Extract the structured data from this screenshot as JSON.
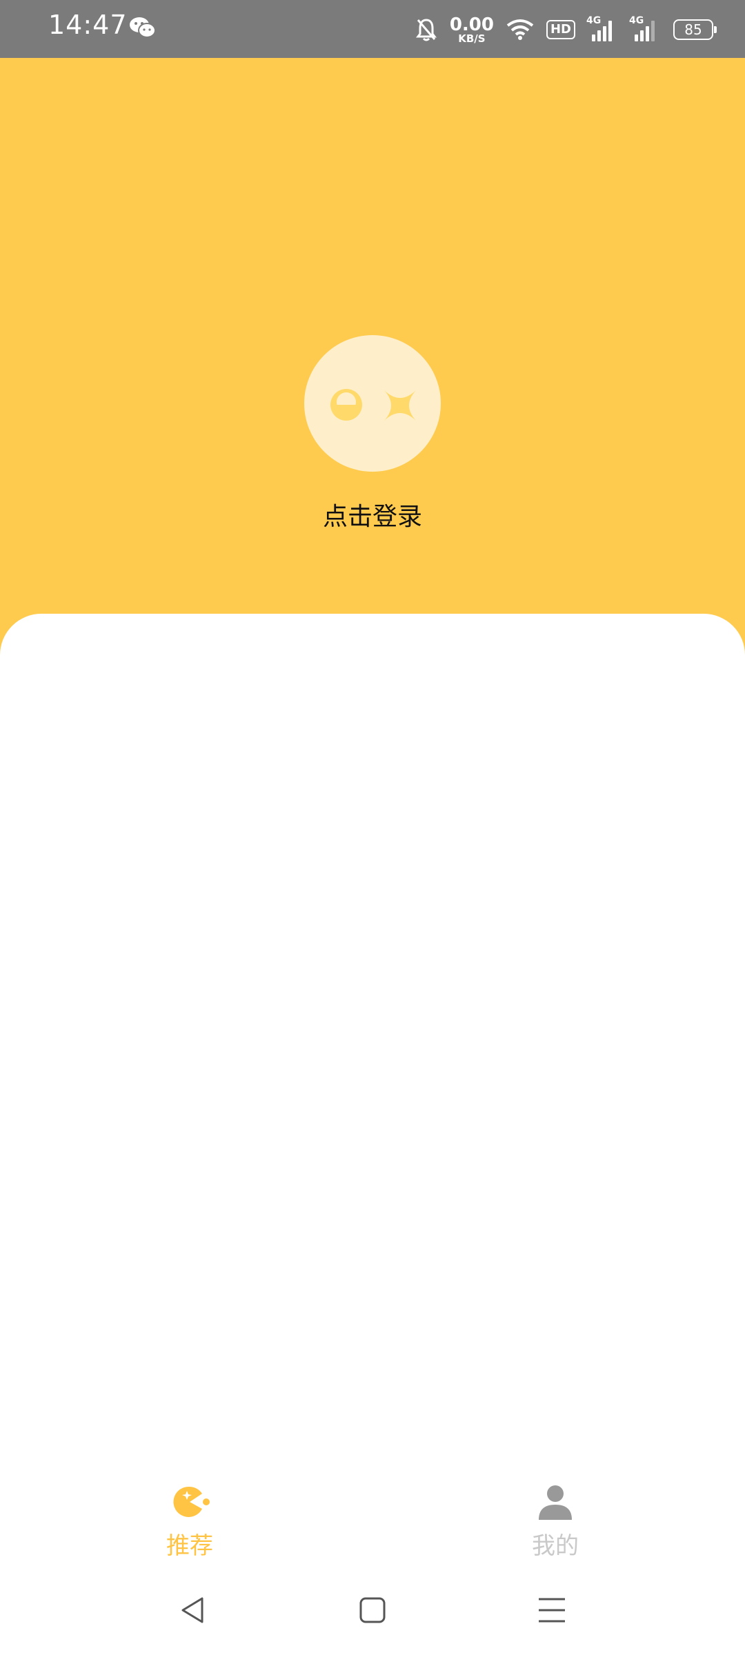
{
  "status_bar": {
    "time": "14:47",
    "net_speed_value": "0.00",
    "net_speed_unit": "KB/S",
    "hd_badge": "HD",
    "signal1_tag": "4G",
    "signal2_tag": "4G",
    "battery": "85",
    "icons": [
      "wechat-icon",
      "bell-off-icon",
      "wifi-icon",
      "hd-icon",
      "signal-icon",
      "battery-icon"
    ]
  },
  "header": {
    "login_text": "点击登录",
    "accent_color": "#ffcb4f"
  },
  "tabs": [
    {
      "label": "推荐",
      "icon": "pacman-icon",
      "active": true
    },
    {
      "label": "我的",
      "icon": "person-icon",
      "active": false
    }
  ],
  "system_nav": [
    "back-icon",
    "home-icon",
    "menu-icon"
  ]
}
